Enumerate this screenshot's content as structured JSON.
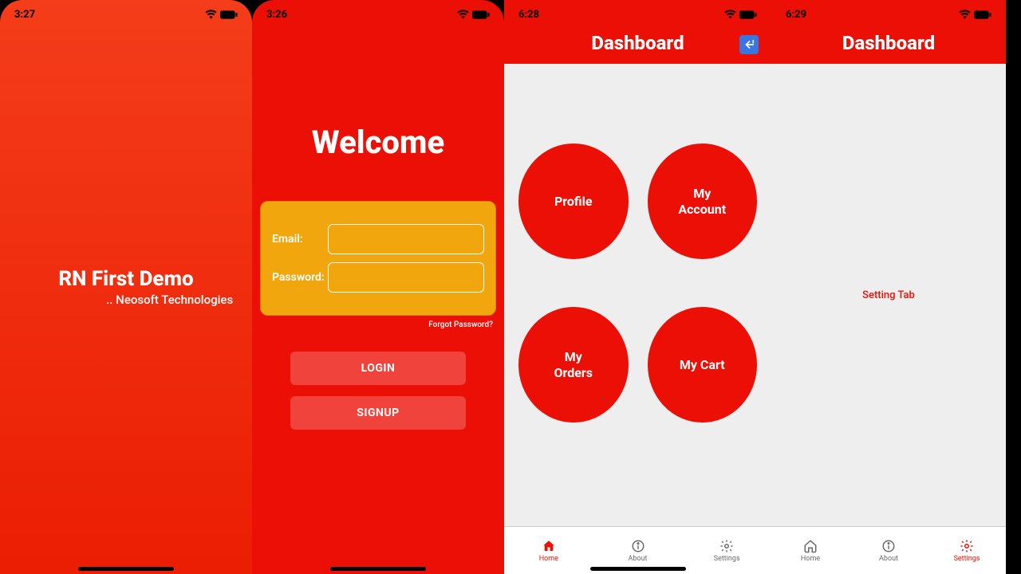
{
  "colors": {
    "brand_red": "#eb0f05",
    "orange_card": "#f2a60d"
  },
  "screen1": {
    "time": "3:27",
    "title": "RN First Demo",
    "subtitle": ".. Neosoft Technologies"
  },
  "screen2": {
    "time": "3:26",
    "heading": "Welcome",
    "email_label": "Email:",
    "password_label": "Password:",
    "forgot": "Forgot Password?",
    "login_label": "LOGIN",
    "signup_label": "SIGNUP"
  },
  "screen3": {
    "time": "6:28",
    "header_title": "Dashboard",
    "tiles": [
      "Profile",
      "My Account",
      "My Orders",
      "My Cart"
    ],
    "tabs": [
      {
        "label": "Home",
        "icon": "home-icon",
        "active": true
      },
      {
        "label": "About",
        "icon": "info-icon",
        "active": false
      },
      {
        "label": "Settings",
        "icon": "gear-icon",
        "active": false
      }
    ]
  },
  "screen4": {
    "time": "6:29",
    "header_title": "Dashboard",
    "body_text": "Setting Tab",
    "tabs": [
      {
        "label": "Home",
        "icon": "home-icon",
        "active": false
      },
      {
        "label": "About",
        "icon": "info-icon",
        "active": false
      },
      {
        "label": "Settings",
        "icon": "gear-icon",
        "active": true
      }
    ]
  }
}
